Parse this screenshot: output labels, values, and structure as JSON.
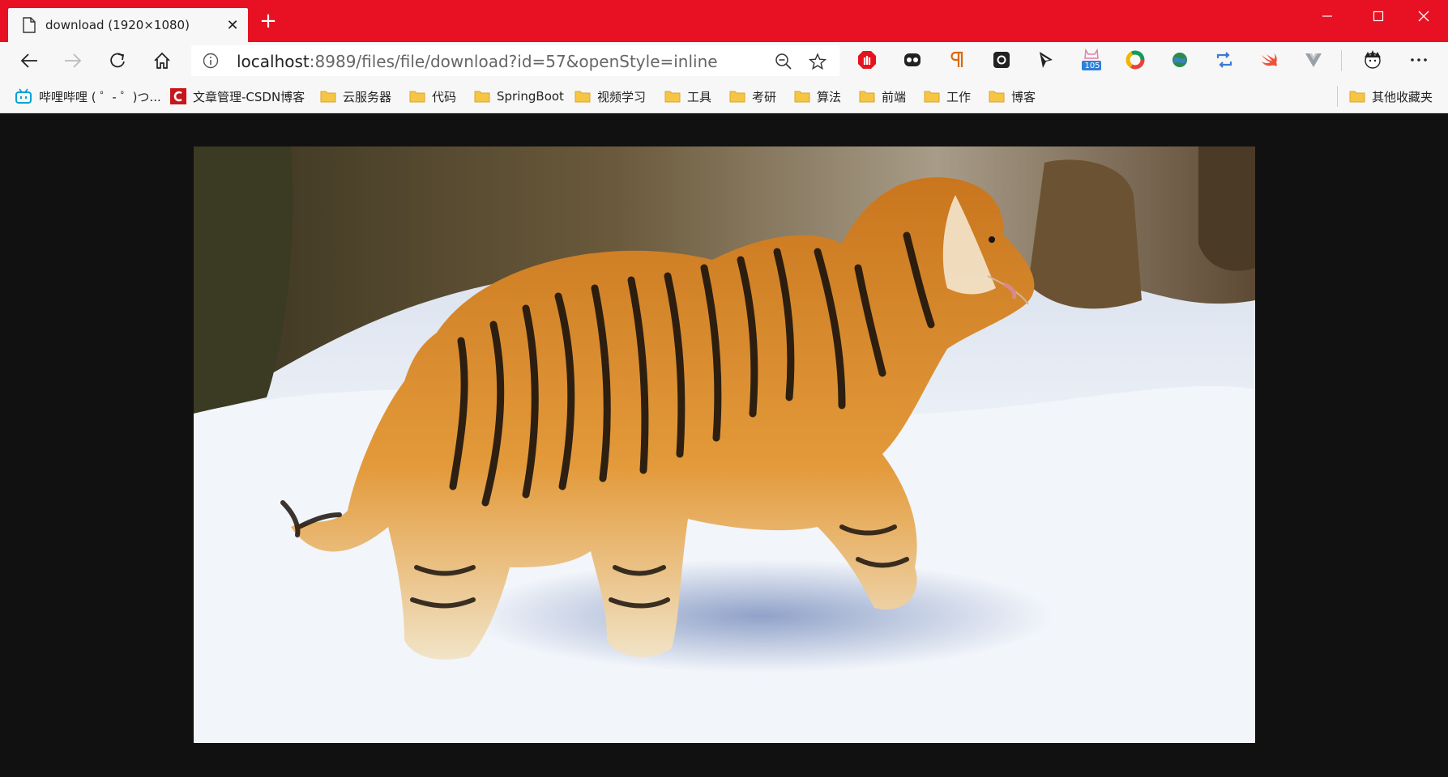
{
  "tab": {
    "title": "download (1920×1080)",
    "close": "✕",
    "new_tab": "+"
  },
  "window": {
    "minimize": "—",
    "maximize": "☐",
    "close": "✕"
  },
  "address_bar": {
    "host": "localhost",
    "path": ":8989/files/file/download?id=57&openStyle=inline"
  },
  "extension_badge": "105",
  "bookmarks": [
    {
      "label": "哔哩哔哩 ( ゜- ゜)つ...",
      "icon": "bilibili-icon"
    },
    {
      "label": "文章管理-CSDN博客",
      "icon": "csdn-icon"
    },
    {
      "label": "云服务器",
      "icon": "folder-icon"
    },
    {
      "label": "代码",
      "icon": "folder-icon"
    },
    {
      "label": "SpringBoot",
      "icon": "folder-icon"
    },
    {
      "label": "视频学习",
      "icon": "folder-icon"
    },
    {
      "label": "工具",
      "icon": "folder-icon"
    },
    {
      "label": "考研",
      "icon": "folder-icon"
    },
    {
      "label": "算法",
      "icon": "folder-icon"
    },
    {
      "label": "前端",
      "icon": "folder-icon"
    },
    {
      "label": "工作",
      "icon": "folder-icon"
    },
    {
      "label": "博客",
      "icon": "folder-icon"
    }
  ],
  "other_bookmarks": "其他收藏夹",
  "colors": {
    "titlebar": "#e81123",
    "toolbar": "#f7f7f7",
    "viewer_background": "#111111"
  }
}
